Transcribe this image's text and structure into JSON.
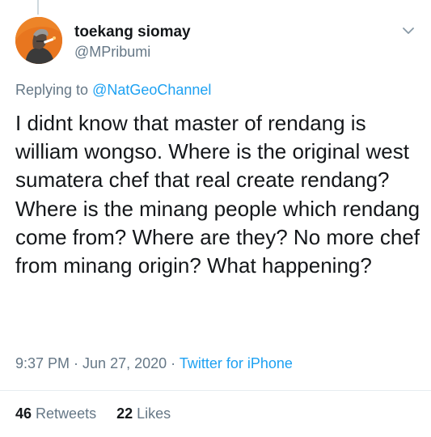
{
  "tweet": {
    "author": {
      "display_name": "toekang siomay",
      "handle": "@MPribumi"
    },
    "replying_to": {
      "prefix": "Replying to",
      "mention": "@NatGeoChannel"
    },
    "text": "I didnt know that master of rendang is william wongso. Where is the original west sumatera chef that real create rendang?\nWhere is the minang people which rendang come from? Where are they? No more chef from minang origin? What happening?",
    "meta": {
      "time": "9:37 PM",
      "sep1": " · ",
      "date": "Jun 27, 2020",
      "sep2": " · ",
      "source": "Twitter for iPhone"
    },
    "stats": {
      "retweets_count": "46",
      "retweets_label": "Retweets",
      "likes_count": "22",
      "likes_label": "Likes"
    }
  },
  "icons": {
    "menu": "chevron-down-icon"
  },
  "colors": {
    "link": "#1da1f2",
    "secondary_text": "#657786",
    "primary_text": "#14171a",
    "avatar_bg": "#e8761f"
  }
}
